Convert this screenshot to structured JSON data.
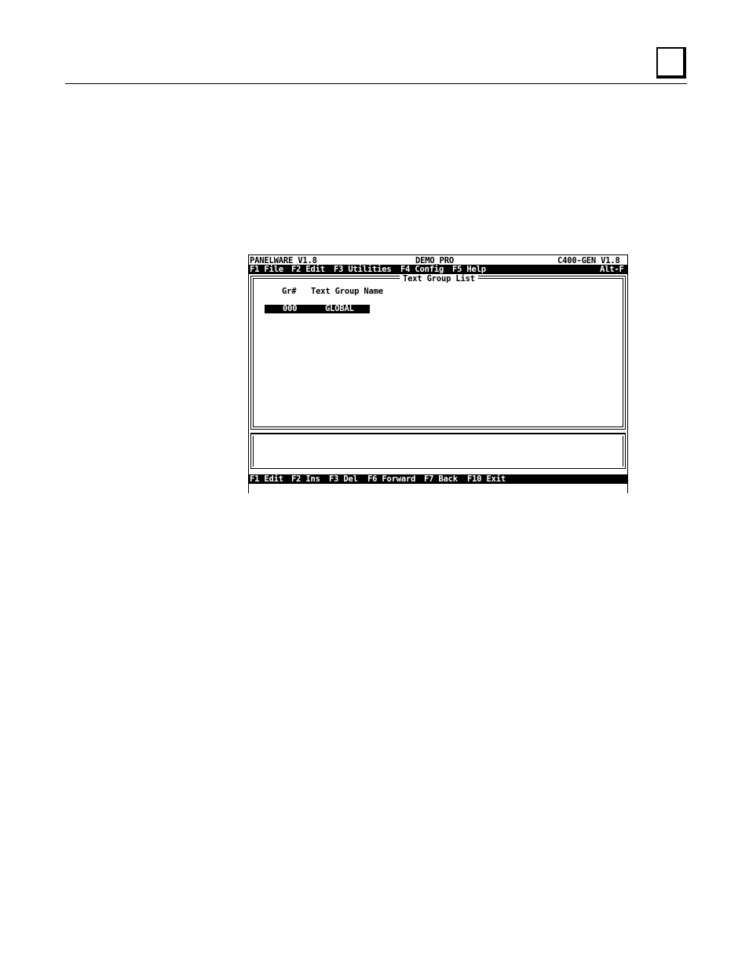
{
  "header": {
    "app_name": "PANELWARE V1.8",
    "project": "DEMO_PRO",
    "target": "C400-GEN V1.8"
  },
  "menu": {
    "items": [
      {
        "label": "F1 File"
      },
      {
        "label": "F2 Edit"
      },
      {
        "label": "F3 Utilities"
      },
      {
        "label": "F4 Config"
      },
      {
        "label": "F5 Help"
      }
    ],
    "shortcut": "Alt-F"
  },
  "text_group_list": {
    "title": "Text Group List",
    "columns": [
      "Gr#",
      "Text Group Name"
    ],
    "rows": [
      {
        "number": "000",
        "name": "GLOBAL",
        "selected": true
      }
    ]
  },
  "function_keys": [
    {
      "label": "F1 Edit"
    },
    {
      "label": "F2 Ins"
    },
    {
      "label": "F3 Del"
    },
    {
      "label": "F6 Forward"
    },
    {
      "label": "F7 Back"
    },
    {
      "label": "F10 Exit"
    }
  ]
}
